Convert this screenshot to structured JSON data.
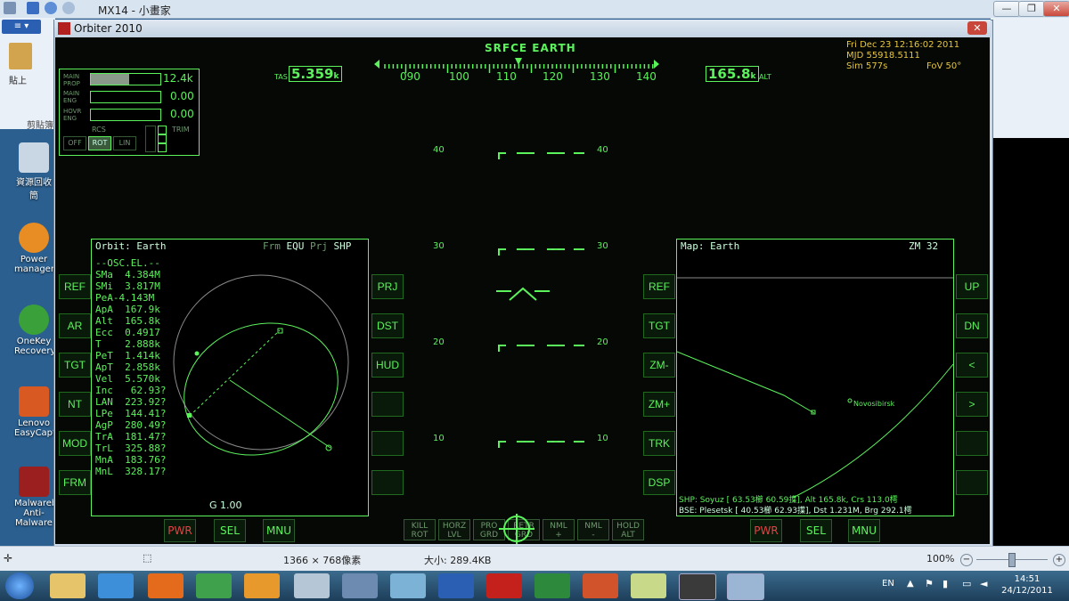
{
  "paint": {
    "title": "MX14 - 小畫家",
    "ribbon_tab": "≡ ▾",
    "paste_label": "貼上",
    "clipboard_group": "剪貼簿",
    "status_dimensions": "1366 × 768像素",
    "status_size": "大小: 289.4KB",
    "zoom": "100%"
  },
  "desktop": {
    "icons": [
      {
        "label": "資源回收筒"
      },
      {
        "label": "Power manager"
      },
      {
        "label": "OneKey Recovery"
      },
      {
        "label": "Lenovo EasyCapture"
      },
      {
        "label": "Malwarebytes Anti-Malware"
      }
    ]
  },
  "orbiter": {
    "window_title": "Orbiter 2010",
    "hud": {
      "mode": "SRFCE  EARTH",
      "heading_ticks": [
        "090",
        "100",
        "110",
        "120",
        "130",
        "140"
      ],
      "tas_label": "TAS",
      "tas_value": "5.359",
      "tas_unit": "k",
      "alt_value": "165.8",
      "alt_unit": "k",
      "alt_label": "ALT",
      "pitch": [
        {
          "l": "40",
          "r": "40"
        },
        {
          "l": "30",
          "r": "30"
        },
        {
          "l": "20",
          "r": "20"
        },
        {
          "l": "10",
          "r": "10"
        }
      ]
    },
    "clock": {
      "date": "Fri Dec 23 12:16:02 2011",
      "mjd": "MJD 55918.5111",
      "sim": "Sim  577s",
      "fov": "FoV  50°"
    },
    "engine": {
      "main_prop_label": "MAIN PROP",
      "main_prop_value": "12.4k",
      "main_prop_fill": 0.55,
      "main_eng_label": "MAIN ENG",
      "main_eng_value": "0.00",
      "hovr_eng_label": "HOVR ENG",
      "hovr_eng_value": "0.00",
      "rcs_label": "RCS",
      "rcs_off": "OFF",
      "rcs_rot": "ROT",
      "rcs_lin": "LIN",
      "trim_label": "TRIM"
    },
    "left_mfd": {
      "title": "Orbit: Earth",
      "frm_label": "Frm",
      "frm_value": "EQU",
      "prj_label": "Prj",
      "prj_value": "SHP",
      "lines": [
        "--OSC.EL.--",
        "SMa  4.384M",
        "SMi  3.817M",
        "PeA-4.143M",
        "ApA  167.9k",
        "Alt  165.8k",
        "Ecc  0.4917",
        "T    2.888k",
        "PeT  1.414k",
        "ApT  2.858k",
        "Vel  5.570k",
        "Inc   62.93?",
        "LAN  223.92?",
        "LPe  144.41?",
        "AgP  280.49?",
        "TrA  181.47?",
        "TrL  325.88?",
        "MnA  183.76?",
        "MnL  328.17?"
      ],
      "footer": "G 1.00",
      "left_buttons": [
        "REF",
        "AR",
        "TGT",
        "NT",
        "MOD",
        "FRM"
      ],
      "right_buttons": [
        "PRJ",
        "DST",
        "HUD",
        "",
        "",
        ""
      ],
      "bottom_buttons": [
        "PWR",
        "SEL",
        "MNU"
      ]
    },
    "center_buttons": [
      {
        "a": "KILL",
        "b": "ROT"
      },
      {
        "a": "HORZ",
        "b": "LVL"
      },
      {
        "a": "PRO",
        "b": "GRD"
      },
      {
        "a": "RETR",
        "b": "GRD"
      },
      {
        "a": "NML",
        "b": "+"
      },
      {
        "a": "NML",
        "b": "-"
      },
      {
        "a": "HOLD",
        "b": "ALT"
      }
    ],
    "right_mfd": {
      "title": "Map: Earth",
      "zoom": "ZM 32",
      "place": "Novosibirsk",
      "shp_line": "SHP:  Soyuz [ 63.53櫛  60.59擛], Alt  165.8k, Crs 113.0樗",
      "bse_line": "BSE:  Plesetsk [ 40.53櫛  62.93擛], Dst 1.231M, Brg 292.1樗",
      "left_buttons": [
        "REF",
        "TGT",
        "ZM-",
        "ZM+",
        "TRK",
        "DSP"
      ],
      "right_buttons": [
        "UP",
        "DN",
        "<",
        ">",
        "",
        ""
      ],
      "bottom_buttons": [
        "PWR",
        "SEL",
        "MNU"
      ]
    }
  },
  "taskbar": {
    "lang": "EN",
    "time": "14:51",
    "date": "24/12/2011"
  }
}
